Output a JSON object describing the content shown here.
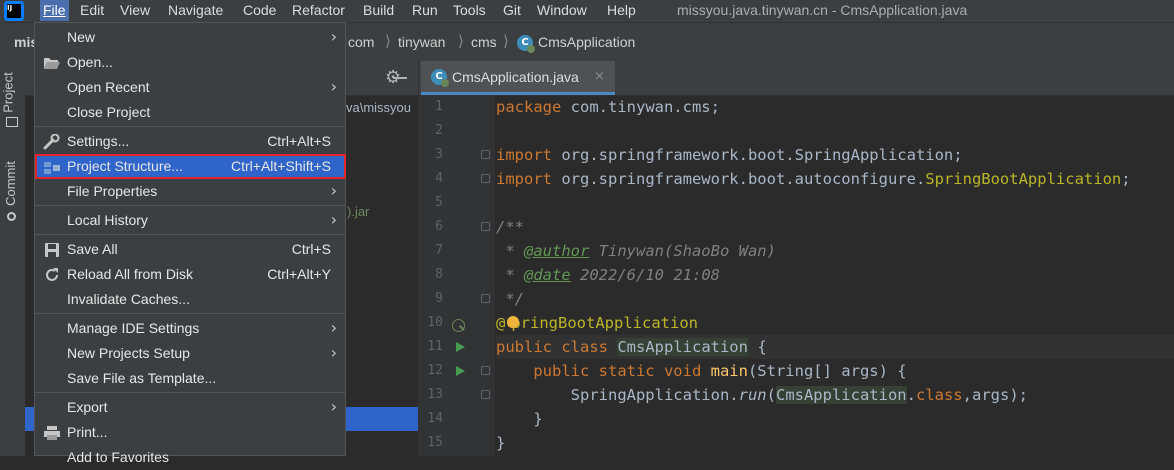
{
  "menubar": {
    "logo_text": "IJ",
    "items": [
      "File",
      "Edit",
      "View",
      "Navigate",
      "Code",
      "Refactor",
      "Build",
      "Run",
      "Tools",
      "Git",
      "Window",
      "Help"
    ],
    "window_title": "missyou.java.tinywan.cn - CmsApplication.java"
  },
  "breadcrumb": {
    "project": "mis",
    "items": [
      "com",
      "tinywan",
      "cms",
      "CmsApplication"
    ]
  },
  "tool_window_tabs": {
    "project": "Project",
    "commit": "Commit"
  },
  "project_tree": {
    "path_fragment": "va\\missyou",
    "jar_fragment": ").jar"
  },
  "file_menu": {
    "items": [
      {
        "label": "New",
        "shortcut": "",
        "submenu": true
      },
      {
        "label": "Open...",
        "shortcut": "",
        "submenu": false
      },
      {
        "label": "Open Recent",
        "shortcut": "",
        "submenu": true
      },
      {
        "label": "Close Project",
        "shortcut": "",
        "submenu": false
      },
      {
        "label": "Settings...",
        "shortcut": "Ctrl+Alt+S",
        "submenu": false
      },
      {
        "label": "Project Structure...",
        "shortcut": "Ctrl+Alt+Shift+S",
        "submenu": false
      },
      {
        "label": "File Properties",
        "shortcut": "",
        "submenu": true
      },
      {
        "label": "Local History",
        "shortcut": "",
        "submenu": true
      },
      {
        "label": "Save All",
        "shortcut": "Ctrl+S",
        "submenu": false
      },
      {
        "label": "Reload All from Disk",
        "shortcut": "Ctrl+Alt+Y",
        "submenu": false
      },
      {
        "label": "Invalidate Caches...",
        "shortcut": "",
        "submenu": false
      },
      {
        "label": "Manage IDE Settings",
        "shortcut": "",
        "submenu": true
      },
      {
        "label": "New Projects Setup",
        "shortcut": "",
        "submenu": true
      },
      {
        "label": "Save File as Template...",
        "shortcut": "",
        "submenu": false
      },
      {
        "label": "Export",
        "shortcut": "",
        "submenu": true
      },
      {
        "label": "Print...",
        "shortcut": "",
        "submenu": false
      },
      {
        "label": "Add to Favorites",
        "shortcut": "",
        "submenu": false
      }
    ],
    "highlighted_item": "Project Structure..."
  },
  "editor": {
    "tab_label": "CmsApplication.java",
    "close_glyph": "×",
    "line_numbers": [
      "1",
      "2",
      "3",
      "4",
      "5",
      "6",
      "7",
      "8",
      "9",
      "10",
      "11",
      "12",
      "13",
      "14",
      "15"
    ],
    "code": {
      "l1_kw": "package",
      "l1_rest": " com.tinywan.cms;",
      "l3_kw": "import",
      "l3_rest": " org.springframework.boot.SpringApplication;",
      "l4_kw": "import",
      "l4_rest": " org.springframework.boot.autoconfigure.",
      "l4_ann": "SpringBootApplication",
      "l4_end": ";",
      "l6": "/**",
      "l7_star": " * ",
      "l7_tag": "@author",
      "l7_text": " Tinywan(ShaoBo Wan)",
      "l8_star": " * ",
      "l8_tag": "@date",
      "l8_text": " 2022/6/10 21:08",
      "l9": " */",
      "l10_at": "@",
      "l10_rest": "pringBootApplication",
      "l11_kw": "public class ",
      "l11_cls": "CmsApplication",
      "l11_end": " {",
      "l12_indent": "    ",
      "l12_kw": "public static void ",
      "l12_mth": "main",
      "l12_end": "(String[] args) {",
      "l13_indent": "        ",
      "l13_cls": "SpringApplication.",
      "l13_mth": "run",
      "l13_open": "(",
      "l13_arg": "CmsApplication",
      "l13_dot": ".",
      "l13_kw": "class",
      "l13_end": ",args);",
      "l14": "    }",
      "l15": "}"
    }
  },
  "colors": {
    "menu_highlight": "#2f65ca",
    "annotation_box": "#e5252a",
    "keyword": "#cc7832"
  }
}
